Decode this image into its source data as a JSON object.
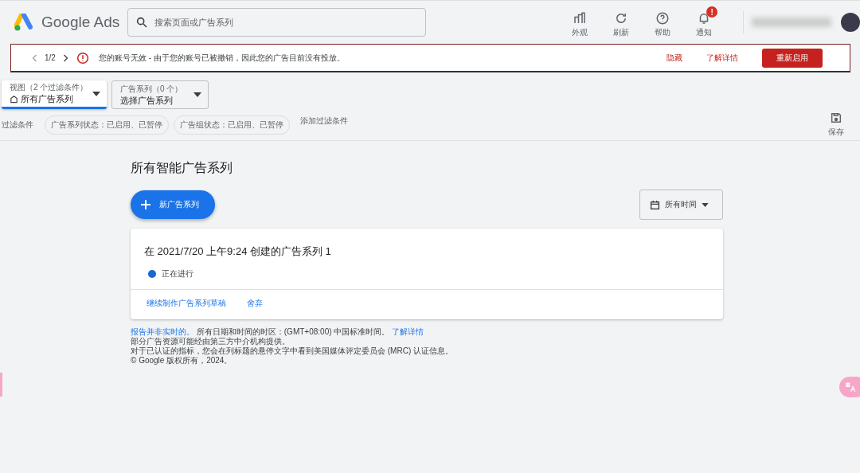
{
  "header": {
    "logo_text": "Google Ads",
    "search": {
      "placeholder": "搜索页面或广告系列"
    },
    "tools": [
      {
        "kind": "appearance",
        "label": "外观"
      },
      {
        "kind": "refresh",
        "label": "刷新"
      },
      {
        "kind": "help",
        "label": "帮助"
      },
      {
        "kind": "notifications",
        "label": "通知",
        "badge": "!"
      }
    ]
  },
  "alert": {
    "pager": "1/2",
    "message": "您的账号无效 - 由于您的账号已被撤销，因此您的广告目前没有投放。",
    "links": [
      "隐藏",
      "了解详情"
    ],
    "button": "重新启用"
  },
  "selectors": [
    {
      "kind": "view",
      "caption": "视图（2 个过滤条件）",
      "value": "所有广告系列",
      "selected": true
    },
    {
      "kind": "campaign",
      "caption": "广告系列（0 个）",
      "value": "选择广告系列",
      "selected": false
    }
  ],
  "filters": {
    "label": "过滤条件",
    "chips": [
      "广告系列状态：已启用、已暂停",
      "广告组状态：已启用、已暂停"
    ],
    "add": "添加过滤条件",
    "save": "保存"
  },
  "page_title": "所有智能广告系列",
  "new_button": "新广告系列",
  "date_range": "所有时间",
  "campaigns": [
    {
      "title": "在 2021/7/20 上午9:24 创建的广告系列 1",
      "status": "正在进行",
      "color": "#1a66d2",
      "actions": [
        "继续制作广告系列草稿",
        "舍弃"
      ]
    }
  ],
  "footer": {
    "line_1_link": "报告并非实时的。",
    "line_1": "所有日期和时间的时区：(GMT+08:00) 中国标准时间。",
    "line_1_more": "了解详情",
    "lines": [
      "部分广告资源可能经由第三方中介机构提供。",
      "对于已认证的指标，您会在列标题的悬停文字中看到美国媒体评定委员会 (MRC) 认证信息。",
      "© Google 版权所有，2024。"
    ]
  }
}
